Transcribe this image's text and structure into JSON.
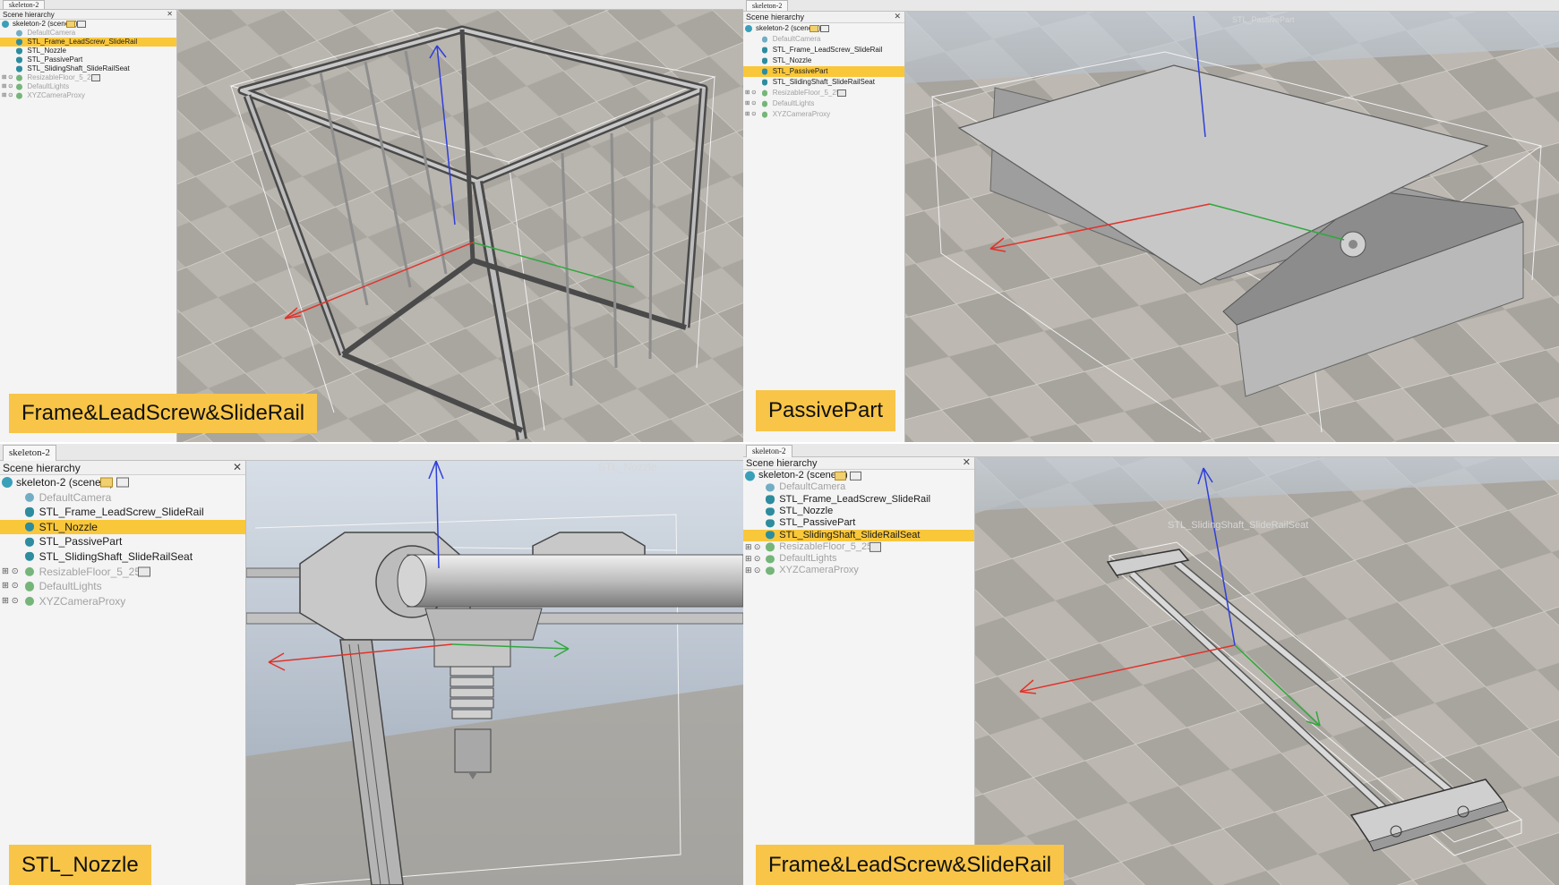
{
  "panels": {
    "frame": {
      "tab": "skeleton-2",
      "hierarchy_title": "Scene hierarchy",
      "root": "skeleton-2 (scene 1)",
      "items": [
        {
          "label": "DefaultCamera",
          "icon": "camera-icon",
          "dim": true,
          "selected": false
        },
        {
          "label": "STL_Frame_LeadScrew_SlideRail",
          "icon": "mesh-icon",
          "dim": false,
          "selected": true
        },
        {
          "label": "STL_Nozzle",
          "icon": "mesh-icon",
          "dim": false,
          "selected": false
        },
        {
          "label": "STL_PassivePart",
          "icon": "mesh-icon",
          "dim": false,
          "selected": false
        },
        {
          "label": "STL_SlidingShaft_SlideRailSeat",
          "icon": "mesh-icon",
          "dim": false,
          "selected": false
        },
        {
          "label": "ResizableFloor_5_25",
          "icon": "floor-icon",
          "dim": true,
          "selected": false
        },
        {
          "label": "DefaultLights",
          "icon": "lights-icon",
          "dim": true,
          "selected": false
        },
        {
          "label": "XYZCameraProxy",
          "icon": "proxy-icon",
          "dim": true,
          "selected": false
        }
      ],
      "caption": "Frame&LeadScrew&SlideRail",
      "viewport_label": ""
    },
    "passive": {
      "tab": "skeleton-2",
      "hierarchy_title": "Scene hierarchy",
      "root": "skeleton-2 (scene 1)",
      "items": [
        {
          "label": "DefaultCamera",
          "icon": "camera-icon",
          "dim": true,
          "selected": false
        },
        {
          "label": "STL_Frame_LeadScrew_SlideRail",
          "icon": "mesh-icon",
          "dim": false,
          "selected": false
        },
        {
          "label": "STL_Nozzle",
          "icon": "mesh-icon",
          "dim": false,
          "selected": false
        },
        {
          "label": "STL_PassivePart",
          "icon": "mesh-icon",
          "dim": false,
          "selected": true
        },
        {
          "label": "STL_SlidingShaft_SlideRailSeat",
          "icon": "mesh-icon",
          "dim": false,
          "selected": false
        },
        {
          "label": "ResizableFloor_5_25",
          "icon": "floor-icon",
          "dim": true,
          "selected": false
        },
        {
          "label": "DefaultLights",
          "icon": "lights-icon",
          "dim": true,
          "selected": false
        },
        {
          "label": "XYZCameraProxy",
          "icon": "proxy-icon",
          "dim": true,
          "selected": false
        }
      ],
      "caption": "PassivePart",
      "viewport_label": "STL_PassivePart"
    },
    "nozzle": {
      "tab": "skeleton-2",
      "hierarchy_title": "Scene hierarchy",
      "root": "skeleton-2 (scene 1)",
      "items": [
        {
          "label": "DefaultCamera",
          "icon": "camera-icon",
          "dim": true,
          "selected": false
        },
        {
          "label": "STL_Frame_LeadScrew_SlideRail",
          "icon": "mesh-icon",
          "dim": false,
          "selected": false
        },
        {
          "label": "STL_Nozzle",
          "icon": "mesh-icon",
          "dim": false,
          "selected": true
        },
        {
          "label": "STL_PassivePart",
          "icon": "mesh-icon",
          "dim": false,
          "selected": false
        },
        {
          "label": "STL_SlidingShaft_SlideRailSeat",
          "icon": "mesh-icon",
          "dim": false,
          "selected": false
        },
        {
          "label": "ResizableFloor_5_25",
          "icon": "floor-icon",
          "dim": true,
          "selected": false
        },
        {
          "label": "DefaultLights",
          "icon": "lights-icon",
          "dim": true,
          "selected": false
        },
        {
          "label": "XYZCameraProxy",
          "icon": "proxy-icon",
          "dim": true,
          "selected": false
        }
      ],
      "caption": "STL_Nozzle",
      "viewport_label": "STL_Nozzle"
    },
    "sliding": {
      "tab": "skeleton-2",
      "hierarchy_title": "Scene hierarchy",
      "root": "skeleton-2 (scene 1)",
      "items": [
        {
          "label": "DefaultCamera",
          "icon": "camera-icon",
          "dim": true,
          "selected": false
        },
        {
          "label": "STL_Frame_LeadScrew_SlideRail",
          "icon": "mesh-icon",
          "dim": false,
          "selected": false
        },
        {
          "label": "STL_Nozzle",
          "icon": "mesh-icon",
          "dim": false,
          "selected": false
        },
        {
          "label": "STL_PassivePart",
          "icon": "mesh-icon",
          "dim": false,
          "selected": false
        },
        {
          "label": "STL_SlidingShaft_SlideRailSeat",
          "icon": "mesh-icon",
          "dim": false,
          "selected": true
        },
        {
          "label": "ResizableFloor_5_25",
          "icon": "floor-icon",
          "dim": true,
          "selected": false
        },
        {
          "label": "DefaultLights",
          "icon": "lights-icon",
          "dim": true,
          "selected": false
        },
        {
          "label": "XYZCameraProxy",
          "icon": "proxy-icon",
          "dim": true,
          "selected": false
        }
      ],
      "caption": "Frame&LeadScrew&SlideRail",
      "viewport_label": "STL_SlidingShaft_SlideRailSeat"
    }
  },
  "colors": {
    "selection": "#f9c73a",
    "caption_bg": "#f8c548",
    "axis_x": "#e0332b",
    "axis_y": "#2fa83c",
    "axis_z": "#2f3fd9",
    "floor_light": "#b9b5af",
    "floor_dark": "#9c9892",
    "sky": "#c9d3de",
    "model_gray": "#c4c4c4"
  }
}
